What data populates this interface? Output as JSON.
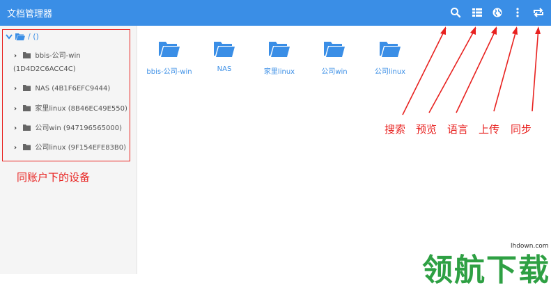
{
  "app_title": "文档管理器",
  "toolbar": {
    "icons": [
      "search-icon",
      "list-view-icon",
      "globe-icon",
      "more-vert-icon",
      "sync-icon"
    ]
  },
  "sidebar": {
    "root_label": "/ ()",
    "items": [
      {
        "name": "bbis-公司-win",
        "id": "(1D4D2C6ACC4C)"
      },
      {
        "label": "NAS (4B1F6EFC9444)"
      },
      {
        "label": "家里linux (8B46EC49E550)"
      },
      {
        "label": "公司win (947196565000)"
      },
      {
        "label": "公司linux (9F154EFE83B0)"
      }
    ]
  },
  "files": [
    "bbis-公司-win",
    "NAS",
    "家里linux",
    "公司win",
    "公司linux"
  ],
  "annotations": {
    "devices": "同账户下的设备",
    "search": "搜索",
    "preview": "预览",
    "language": "语言",
    "upload": "上传",
    "sync": "同步"
  },
  "watermark": {
    "text": "领航下载",
    "url": "lhdown.com"
  },
  "colors": {
    "accent": "#3a8ee6",
    "annotation": "#e8211f",
    "watermark": "#2ea043"
  }
}
